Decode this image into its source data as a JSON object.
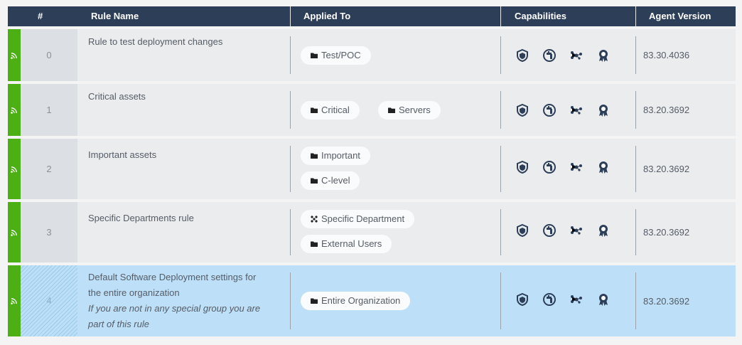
{
  "header": {
    "index": "#",
    "rule_name": "Rule Name",
    "applied_to": "Applied To",
    "capabilities": "Capabilities",
    "agent_version": "Agent Version"
  },
  "rows": [
    {
      "index": "0",
      "name": "Rule to test deployment changes",
      "note": "",
      "tags": [
        {
          "label": "Test/POC",
          "icon": "folder-icon"
        }
      ],
      "version": "83.30.4036",
      "selected": false
    },
    {
      "index": "1",
      "name": "Critical assets",
      "note": "",
      "tags": [
        {
          "label": "Critical",
          "icon": "folder-icon"
        },
        {
          "label": "Servers",
          "icon": "folder-icon"
        }
      ],
      "version": "83.20.3692",
      "selected": false
    },
    {
      "index": "2",
      "name": "Important assets",
      "note": "",
      "tags": [
        {
          "label": "Important",
          "icon": "folder-icon"
        },
        {
          "label": "C-level",
          "icon": "folder-icon"
        }
      ],
      "version": "83.20.3692",
      "selected": false
    },
    {
      "index": "3",
      "name": "Specific Departments rule",
      "note": "",
      "tags": [
        {
          "label": "Specific Department",
          "icon": "org-group-icon"
        },
        {
          "label": "External Users",
          "icon": "folder-icon"
        }
      ],
      "version": "83.20.3692",
      "selected": false
    },
    {
      "index": "4",
      "name_line1": "Default Software Deployment settings for",
      "name_line2": "the entire organization",
      "note_line1": "If you are not in any special group you are",
      "note_line2": "part of this rule",
      "tags": [
        {
          "label": "Entire Organization",
          "icon": "folder-icon"
        }
      ],
      "version": "83.20.3692",
      "selected": true
    }
  ],
  "capability_icons": [
    "shield-icon",
    "faucet-icon",
    "network-nodes-icon",
    "award-ribbon-icon"
  ],
  "colors": {
    "header_bg": "#2d3e58",
    "status_green": "#4caf14",
    "selected_row": "#bde0f8",
    "row_bg": "#ebecee",
    "icon_navy": "#2d3e58"
  }
}
